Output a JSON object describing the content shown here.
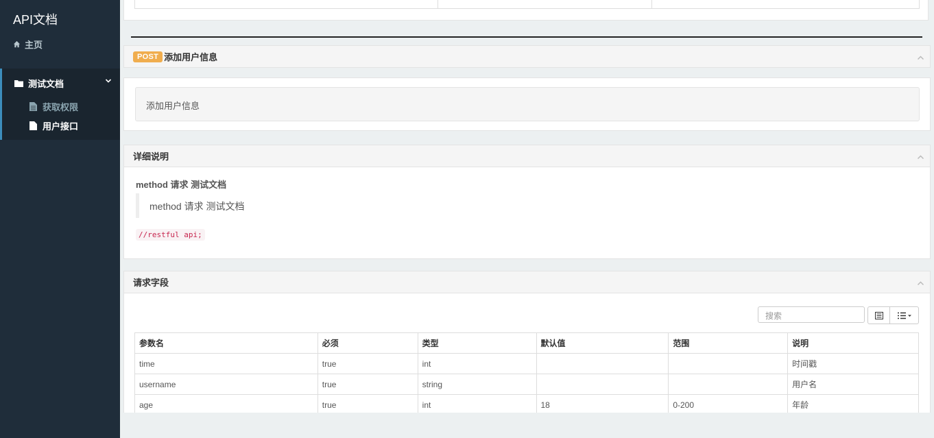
{
  "sidebar": {
    "brand": "API文档",
    "home": "主页",
    "group": {
      "label": "测试文档",
      "items": [
        {
          "label": "获取权限"
        },
        {
          "label": "用户接口"
        }
      ]
    }
  },
  "endpoint": {
    "method": "POST",
    "title": "添加用户信息",
    "description": "添加用户信息"
  },
  "detail": {
    "heading": "详细说明",
    "title": "method 请求 测试文档",
    "quote": "method 请求 测试文档",
    "code": "//restful api;"
  },
  "request_fields": {
    "heading": "请求字段",
    "search_placeholder": "搜索",
    "columns": [
      "参数名",
      "必须",
      "类型",
      "默认值",
      "范围",
      "说明"
    ],
    "rows": [
      [
        "time",
        "true",
        "int",
        "",
        "",
        "时间戳"
      ],
      [
        "username",
        "true",
        "string",
        "",
        "",
        "用户名"
      ],
      [
        "age",
        "true",
        "int",
        "18",
        "0-200",
        "年龄"
      ]
    ]
  },
  "colors": {
    "sidebar_bg": "#1f2d3a",
    "active_accent": "#3c8dbc",
    "post_badge": "#f0ad4e",
    "code_text": "#c7254e"
  }
}
